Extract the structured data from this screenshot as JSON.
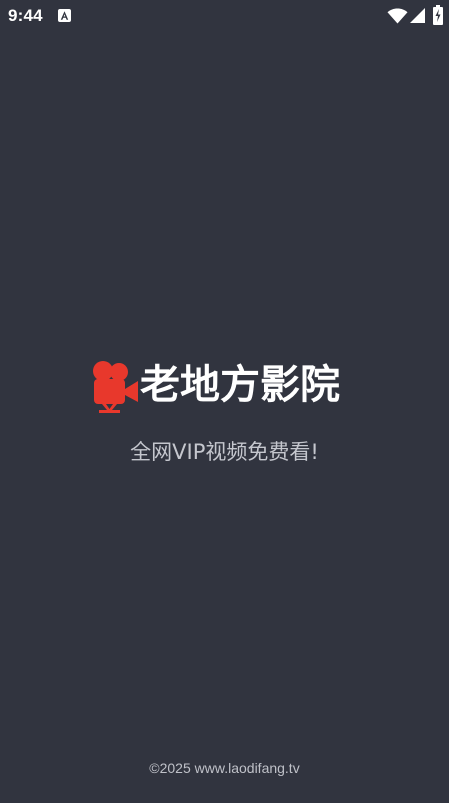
{
  "status_bar": {
    "time": "9:44",
    "notification_icon": "a-app-notification-icon",
    "wifi_icon": "wifi-icon",
    "signal_icon": "cell-signal-icon",
    "battery_icon": "battery-charging-icon"
  },
  "splash": {
    "logo_icon": "movie-camera-icon",
    "app_name": "老地方影院",
    "tagline": "全网VIP视频免费看!",
    "footer": "©2025 www.laodifang.tv"
  },
  "colors": {
    "background": "#31343f",
    "logo_red": "#e8382c",
    "text_primary": "#ffffff",
    "text_secondary": "#c5c7ce"
  }
}
